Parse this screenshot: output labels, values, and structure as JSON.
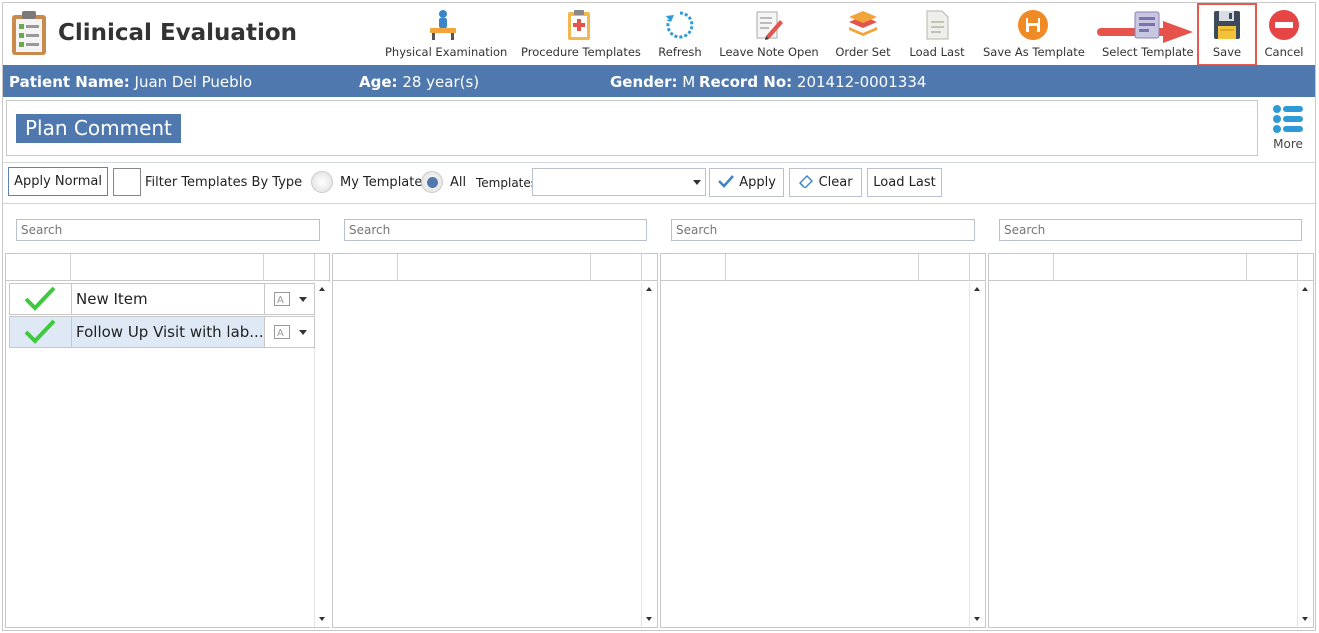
{
  "app": {
    "title": "Clinical Evaluation"
  },
  "toolbar": {
    "physical_examination": "Physical Examination",
    "procedure_templates": "Procedure Templates",
    "refresh": "Refresh",
    "leave_note_open": "Leave Note Open",
    "order_set": "Order Set",
    "load_last": "Load Last",
    "save_as_template": "Save As Template",
    "select_template": "Select Template",
    "save": "Save",
    "cancel": "Cancel"
  },
  "patient": {
    "name_label": "Patient Name:",
    "name": "Juan Del Pueblo",
    "age_label": "Age:",
    "age": "28 year(s)",
    "gender_label": "Gender:",
    "gender": "M",
    "record_label": "Record No:",
    "record": "201412-0001334"
  },
  "section": {
    "title": "Plan Comment",
    "more": "More"
  },
  "filters": {
    "apply_normal": "Apply Normal",
    "filter_by_type": "Filter Templates By Type",
    "my_templates": "My Templates",
    "all": "All",
    "selected_radio": "All",
    "templates_label": "Templates:",
    "templates_value": "",
    "apply": "Apply",
    "clear": "Clear",
    "load_last": "Load Last"
  },
  "panels": [
    {
      "search_placeholder": "Search",
      "items": [
        {
          "name": "New Item",
          "checked": true
        },
        {
          "name": "Follow Up Visit with lab...",
          "checked": true,
          "selected": true
        }
      ]
    },
    {
      "search_placeholder": "Search",
      "items": []
    },
    {
      "search_placeholder": "Search",
      "items": []
    },
    {
      "search_placeholder": "Search",
      "items": []
    }
  ],
  "colors": {
    "accent": "#4f79ae",
    "highlight_box": "#e55a4f",
    "check_green": "#3ec93e"
  }
}
